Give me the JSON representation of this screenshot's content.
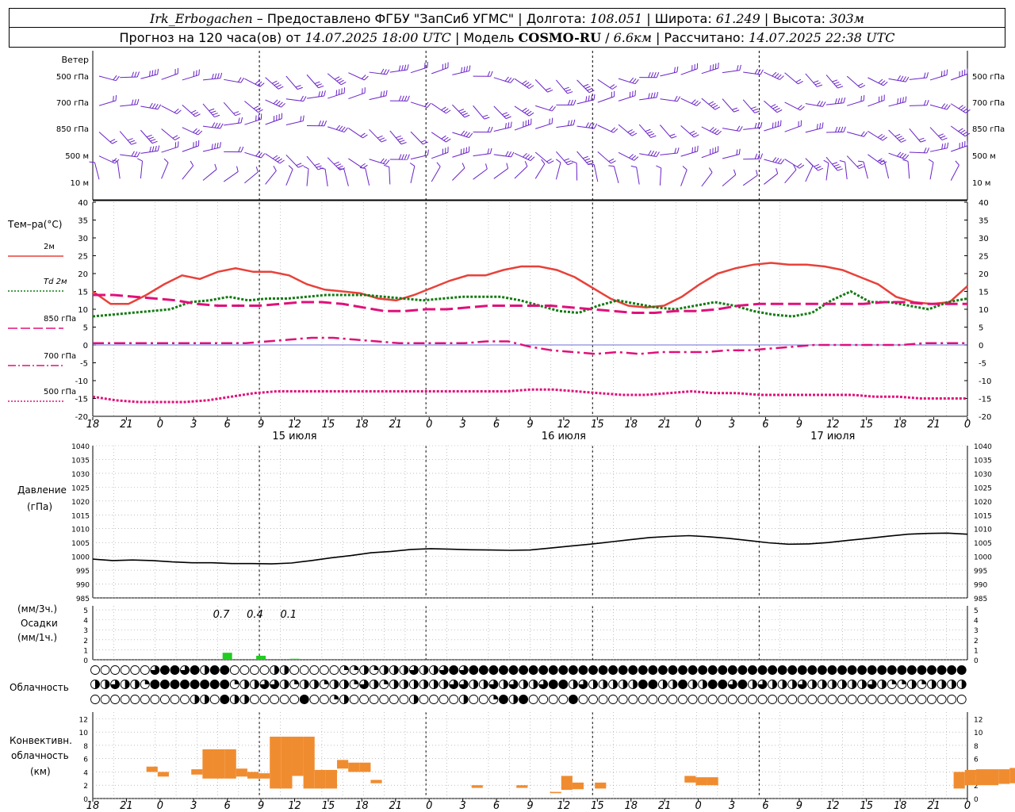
{
  "header": {
    "station": "Irk_Erbogachen",
    "provider": " – Предоставлено ФГБУ \"ЗапСиб УГМС\" | Долгота: ",
    "lon": "108.051",
    "lat_label": " | Широта: ",
    "lat": "61.249",
    "alt_label": " | Высота: ",
    "alt": "303м",
    "fc_label": "Прогноз на 120 часа(ов) от ",
    "fc_time": "14.07.2025 18:00 UTC",
    "model_label": "  | Модель ",
    "model": "COSMO-RU",
    "res_sep": " / ",
    "res": "6.6км",
    "calc_label": " | Рассчитано: ",
    "calc_time": "14.07.2025 22:38 UTC"
  },
  "time_axis": {
    "ticks": [
      "18",
      "21",
      "0",
      "3",
      "6",
      "9",
      "12",
      "15",
      "18",
      "21",
      "0",
      "3",
      "6",
      "9",
      "12",
      "15",
      "18",
      "21",
      "0",
      "3",
      "6",
      "9",
      "12",
      "15",
      "18",
      "21",
      "0"
    ],
    "days": [
      "15 июля",
      "16 июля",
      "17 июля"
    ]
  },
  "wind_panel": {
    "title": "Ветер",
    "levels": [
      "500 гПа",
      "700 гПа",
      "850 гПа",
      "500 м",
      "10 м"
    ]
  },
  "temp_panel": {
    "title": "Тем–ра(°С)",
    "legend": [
      {
        "label": "2м",
        "color": "#e8413a"
      },
      {
        "label": "Td 2м",
        "color": "#127a12"
      },
      {
        "label": "850 гПа",
        "color": "#e0107a"
      },
      {
        "label": "700 гПа",
        "color": "#e0107a"
      },
      {
        "label": "500 гПа",
        "color": "#e0107a"
      }
    ],
    "y_ticks": [
      "40",
      "35",
      "30",
      "25",
      "20",
      "15",
      "10",
      "5",
      "0",
      "-5",
      "-10",
      "-15",
      "-20"
    ]
  },
  "pressure_panel": {
    "title1": "Давление",
    "title2": "(гПа)",
    "y_ticks": [
      "1040",
      "1035",
      "1030",
      "1025",
      "1020",
      "1015",
      "1010",
      "1005",
      "1000",
      "995",
      "990",
      "985"
    ]
  },
  "precip_panel": {
    "unit3": "(мм/3ч.)",
    "title": "Осадки",
    "unit1": "(мм/1ч.)",
    "y_ticks": [
      "5",
      "4",
      "3",
      "2",
      "1",
      "0"
    ],
    "labels": [
      "0.7",
      "0.4",
      "0.1"
    ]
  },
  "cloud_panel": {
    "title": "Облачность"
  },
  "conv_panel": {
    "title1": "Конвективн.",
    "title2": "облачность",
    "title3": "(км)",
    "y_ticks": [
      "12",
      "10",
      "8",
      "6",
      "4",
      "2",
      "0"
    ]
  },
  "chart_data": [
    {
      "type": "line",
      "name": "temperature",
      "x_hours": [
        0,
        3,
        6,
        9,
        12,
        15,
        18,
        21,
        24,
        27,
        30,
        33,
        36,
        39,
        42,
        45,
        48,
        51,
        54,
        57,
        60,
        63,
        66,
        69,
        72,
        75,
        78,
        81,
        84,
        87,
        90,
        93,
        96,
        99,
        102,
        105,
        108,
        111,
        114,
        117,
        120,
        123,
        126
      ],
      "ylim": [
        -20,
        40
      ],
      "series": [
        {
          "name": "2м",
          "color": "#e8413a",
          "values": [
            15,
            11.5,
            11.5,
            14,
            17,
            19.5,
            18.5,
            20.5,
            21.5,
            20.5,
            20.5,
            19.5,
            17,
            15.5,
            15,
            14.5,
            13,
            12.5,
            14,
            16,
            18,
            19.5,
            19.5,
            21,
            22,
            22,
            21,
            19,
            16,
            13,
            11,
            10.5,
            11,
            13.5,
            17,
            20,
            21.5,
            22.5,
            23,
            22.5,
            22.5,
            22,
            21,
            19,
            17,
            13.5,
            12,
            11.5,
            12,
            16.5
          ]
        },
        {
          "name": "Td 2м",
          "color": "#127a12",
          "values": [
            8,
            8.5,
            9,
            9.5,
            10,
            12,
            12.5,
            13.5,
            12.5,
            13,
            13,
            13.5,
            14,
            14,
            14,
            13.5,
            13,
            12.5,
            13,
            13.5,
            13.5,
            13.5,
            12.5,
            11,
            9.5,
            9,
            11,
            12.5,
            11.5,
            10.5,
            10,
            11,
            12,
            11,
            9.5,
            8.5,
            8,
            9,
            12.5,
            15,
            12,
            12,
            11,
            10,
            12,
            13
          ]
        },
        {
          "name": "850 гПа",
          "color": "#e0107a",
          "values": [
            14,
            14,
            13.5,
            13,
            12.5,
            11.5,
            11,
            11,
            11,
            11.5,
            12,
            12,
            11.5,
            10.5,
            9.5,
            9.5,
            10,
            10,
            10.5,
            11,
            11,
            11,
            11,
            10.5,
            10,
            9.5,
            9,
            9,
            9.5,
            9.5,
            10,
            11,
            11.5,
            11.5,
            11.5,
            11.5,
            11.5,
            11.5,
            12,
            12,
            11.5,
            11.5,
            11.5
          ]
        },
        {
          "name": "700 гПа",
          "color": "#e0107a",
          "values": [
            0.5,
            0.5,
            0.5,
            0.5,
            0.5,
            0.5,
            0.5,
            0.5,
            1,
            1.5,
            2,
            2,
            1.5,
            1,
            0.5,
            0.5,
            0.5,
            0.5,
            1,
            1,
            -0.5,
            -1.5,
            -2,
            -2.5,
            -2,
            -2.5,
            -2,
            -2,
            -2,
            -1.5,
            -1.5,
            -1,
            -0.5,
            0,
            0,
            0,
            0,
            0,
            0.5,
            0.5,
            0.5
          ]
        },
        {
          "name": "500 гПа",
          "color": "#e0107a",
          "values": [
            -14.5,
            -15.5,
            -16,
            -16,
            -16,
            -15.5,
            -14.5,
            -13.5,
            -13,
            -13,
            -13,
            -13,
            -13,
            -13,
            -13,
            -13,
            -13,
            -13,
            -13,
            -12.5,
            -12.5,
            -13,
            -13.5,
            -14,
            -14,
            -13.5,
            -13,
            -13.5,
            -13.5,
            -14,
            -14,
            -14,
            -14,
            -14,
            -14.5,
            -14.5,
            -15,
            -15,
            -15
          ]
        }
      ]
    },
    {
      "type": "line",
      "name": "pressure",
      "ylim": [
        985,
        1040
      ],
      "series": [
        {
          "name": "Давление",
          "values": [
            999,
            998.5,
            998.7,
            998.5,
            998,
            997.7,
            997.7,
            997.4,
            997.4,
            997.3,
            997.6,
            998.5,
            999.5,
            1000.3,
            1001.3,
            1001.8,
            1002.5,
            1002.8,
            1002.6,
            1002.4,
            1002.3,
            1002.2,
            1002.3,
            1003,
            1003.7,
            1004.4,
            1005.2,
            1006,
            1006.8,
            1007.2,
            1007.5,
            1007.1,
            1006.5,
            1005.7,
            1004.9,
            1004.4,
            1004.5,
            1005,
            1005.8,
            1006.5,
            1007.3,
            1008,
            1008.3,
            1008.4,
            1008
          ]
        }
      ]
    },
    {
      "type": "bar",
      "name": "precipitation",
      "ylim": [
        0,
        5
      ],
      "bars": [
        {
          "hour": 12,
          "value": 0.7
        },
        {
          "hour": 15,
          "value": 0.4
        },
        {
          "hour": 18,
          "value": 0.1
        }
      ],
      "color": "#22cc22"
    },
    {
      "type": "bar",
      "name": "convective_cloud",
      "ylim": [
        0,
        12
      ],
      "color": "#f08c30",
      "bars": [
        {
          "h": 5,
          "b": 4,
          "t": 4.8
        },
        {
          "h": 6,
          "b": 3.3,
          "t": 4
        },
        {
          "h": 9,
          "b": 3.6,
          "t": 4.4
        },
        {
          "h": 10,
          "b": 3,
          "t": 7.4
        },
        {
          "h": 11,
          "b": 3,
          "t": 7.4
        },
        {
          "h": 12,
          "b": 3,
          "t": 7.4
        },
        {
          "h": 13,
          "b": 3.3,
          "t": 4.5
        },
        {
          "h": 14,
          "b": 3,
          "t": 4
        },
        {
          "h": 15,
          "b": 3,
          "t": 3.8
        },
        {
          "h": 16,
          "b": 1.5,
          "t": 9.3
        },
        {
          "h": 17,
          "b": 1.5,
          "t": 9.3
        },
        {
          "h": 18,
          "b": 3.4,
          "t": 9.3
        },
        {
          "h": 19,
          "b": 1.5,
          "t": 9.3
        },
        {
          "h": 20,
          "b": 1.5,
          "t": 4.3
        },
        {
          "h": 21,
          "b": 1.5,
          "t": 4.3
        },
        {
          "h": 22,
          "b": 4.5,
          "t": 5.8
        },
        {
          "h": 23,
          "b": 4,
          "t": 5.4
        },
        {
          "h": 24,
          "b": 4,
          "t": 5.4
        },
        {
          "h": 25,
          "b": 2.3,
          "t": 2.8
        },
        {
          "h": 34,
          "b": 1.6,
          "t": 2
        },
        {
          "h": 38,
          "b": 1.6,
          "t": 2
        },
        {
          "h": 41,
          "b": 0.8,
          "t": 1
        },
        {
          "h": 42,
          "b": 1.3,
          "t": 3.4
        },
        {
          "h": 43,
          "b": 1.4,
          "t": 2.4
        },
        {
          "h": 45,
          "b": 1.5,
          "t": 2.4
        },
        {
          "h": 53,
          "b": 2.4,
          "t": 3.4
        },
        {
          "h": 54,
          "b": 2,
          "t": 3.2
        },
        {
          "h": 55,
          "b": 2,
          "t": 3.2
        },
        {
          "h": 77,
          "b": 1.5,
          "t": 4
        },
        {
          "h": 78,
          "b": 2,
          "t": 4.3
        },
        {
          "h": 79,
          "b": 2,
          "t": 4.4
        },
        {
          "h": 80,
          "b": 2,
          "t": 4.4
        },
        {
          "h": 81,
          "b": 2.2,
          "t": 4.4
        },
        {
          "h": 82,
          "b": 2.3,
          "t": 4.6
        },
        {
          "h": 83,
          "b": 2.3,
          "t": 4.9
        },
        {
          "h": 84,
          "b": 2.3,
          "t": 4.9
        },
        {
          "h": 85,
          "b": 2.5,
          "t": 4.9
        },
        {
          "h": 86,
          "b": 2.3,
          "t": 4.9
        },
        {
          "h": 88,
          "b": 2.6,
          "t": 3
        },
        {
          "h": 89,
          "b": 2.2,
          "t": 4.7
        },
        {
          "h": 90,
          "b": 2,
          "t": 5.2
        },
        {
          "h": 91,
          "b": 2.1,
          "t": 2.4
        }
      ]
    },
    {
      "type": "table",
      "name": "cloudiness",
      "note": "fraction of cloud cover per row (upper/middle/lower)",
      "rows": [
        [
          0,
          0,
          0,
          0,
          0,
          0,
          0.75,
          1,
          1,
          0.75,
          1,
          0.5,
          1,
          1,
          0,
          0,
          0,
          0,
          0.5,
          0.5,
          0,
          0,
          0,
          0,
          0,
          0.25,
          0.25,
          0.5,
          0.25,
          0.5,
          0.5,
          0.5,
          0.75,
          0.5,
          0.5,
          0.75,
          1,
          0.75,
          1,
          1,
          1,
          1,
          1,
          1,
          1,
          1,
          1,
          1,
          1,
          1,
          1,
          1,
          1,
          1,
          1,
          1,
          1,
          1,
          1,
          1,
          1,
          1,
          1,
          1,
          1,
          1,
          1,
          1,
          1,
          1,
          1,
          1,
          1,
          1,
          1,
          1,
          1,
          1,
          1,
          1,
          1,
          1,
          1,
          1,
          1,
          1,
          1,
          1,
          0.5,
          1,
          0.25,
          0,
          0.5,
          0,
          0,
          0,
          0,
          0,
          0,
          0,
          0,
          0,
          0,
          0,
          0,
          0,
          0,
          0,
          0,
          0,
          0,
          0,
          0,
          0,
          0,
          0,
          0,
          0,
          0,
          0,
          0,
          0,
          0,
          0,
          0
        ],
        [
          0.5,
          0.5,
          0.75,
          0.5,
          0.5,
          0.25,
          1,
          1,
          1,
          1,
          1,
          1,
          1,
          1,
          0.25,
          0.5,
          0.5,
          0.75,
          0.75,
          0.5,
          0.25,
          0.5,
          0.5,
          0.25,
          0.5,
          0.5,
          0.25,
          0.75,
          0.5,
          0.25,
          0.5,
          0.5,
          0.5,
          0.5,
          0.5,
          0.5,
          0.75,
          0.75,
          0.5,
          0.5,
          0.75,
          0.5,
          0.75,
          0.5,
          0.5,
          0.75,
          1,
          1,
          0.5,
          0.75,
          0.5,
          0.5,
          0.5,
          0.5,
          0.5,
          1,
          1,
          0.5,
          0.5,
          1,
          0.5,
          0.5,
          1,
          1,
          0.75,
          1,
          0.5,
          0.75,
          0.5,
          0.5,
          0.5,
          0.75,
          0.5,
          0.5,
          0.5,
          0.5,
          0.5,
          0.5,
          0.75,
          0.5,
          0.25,
          0.25,
          0.5,
          0.25,
          0.5,
          0.5,
          0.5,
          0.5,
          0.25,
          0.5,
          0.5,
          0.5,
          0.5,
          0.25,
          0.5,
          0.25,
          0.5,
          0.5,
          0.25,
          0.5,
          0.5,
          0.25,
          0.5,
          0.5,
          0.25,
          0.5,
          0.5,
          0.25,
          0.25,
          0.5,
          0.25,
          0.5,
          0.5,
          0.25,
          0.25,
          0.25,
          0.5,
          0.25,
          0.25,
          0.5,
          0.25,
          0.25
        ],
        [
          0,
          0,
          0,
          0,
          0,
          0,
          0,
          0,
          0,
          0,
          0.5,
          0.5,
          0,
          1,
          0.5,
          0.5,
          0,
          0,
          0,
          0,
          0,
          1,
          0,
          0,
          0.25,
          0.5,
          0,
          0,
          0,
          0,
          0,
          0,
          0.5,
          0,
          0,
          0,
          0,
          0.5,
          0,
          0,
          0.25,
          1,
          0.5,
          1,
          0,
          0,
          0,
          0,
          1,
          0,
          0,
          0,
          0,
          0,
          0,
          0,
          0,
          0,
          0,
          0,
          0,
          0,
          0,
          0,
          0,
          0,
          0,
          0,
          0,
          0,
          0,
          0,
          0,
          0,
          0,
          0,
          0,
          0,
          0,
          0,
          0,
          0,
          0,
          0,
          0,
          0,
          0,
          0,
          0,
          0,
          0,
          0,
          0,
          0,
          0,
          0,
          0,
          0,
          0,
          0,
          0,
          0,
          0,
          0,
          0,
          0,
          0,
          0,
          0,
          0,
          0,
          0,
          0,
          0,
          0,
          0.25,
          0.5,
          1,
          1,
          1,
          1
        ]
      ]
    }
  ]
}
